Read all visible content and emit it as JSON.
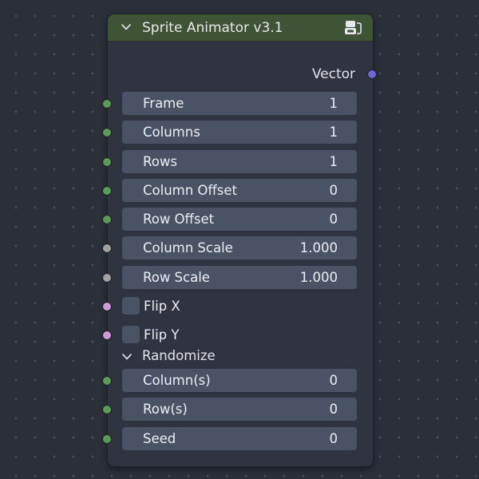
{
  "node": {
    "title": "Sprite Animator v3.1",
    "header_color": "#3f5434",
    "header_icon": "node-group-icon",
    "output": {
      "label": "Vector",
      "socket_color": "#6c67d4"
    },
    "fields": [
      {
        "label": "Frame",
        "value": "1",
        "socket": "green"
      },
      {
        "label": "Columns",
        "value": "1",
        "socket": "green"
      },
      {
        "label": "Rows",
        "value": "1",
        "socket": "green"
      },
      {
        "label": "Column Offset",
        "value": "0",
        "socket": "green"
      },
      {
        "label": "Row Offset",
        "value": "0",
        "socket": "green"
      },
      {
        "label": "Column Scale",
        "value": "1.000",
        "socket": "gray"
      },
      {
        "label": "Row Scale",
        "value": "1.000",
        "socket": "gray"
      }
    ],
    "checkboxes": [
      {
        "label": "Flip X",
        "checked": false,
        "socket": "pink"
      },
      {
        "label": "Flip Y",
        "checked": false,
        "socket": "pink"
      }
    ],
    "panel": {
      "label": "Randomize",
      "expanded": true,
      "fields": [
        {
          "label": "Column(s)",
          "value": "0",
          "socket": "green"
        },
        {
          "label": "Row(s)",
          "value": "0",
          "socket": "green"
        },
        {
          "label": "Seed",
          "value": "0",
          "socket": "green"
        }
      ]
    }
  },
  "colors": {
    "background": "#2b2f38",
    "node_body": "#303440",
    "field": "#4a5366",
    "socket_int": "#5a9b5a",
    "socket_float": "#a1a1a1",
    "socket_bool": "#cf9ad8",
    "socket_vector": "#6c67d4"
  }
}
